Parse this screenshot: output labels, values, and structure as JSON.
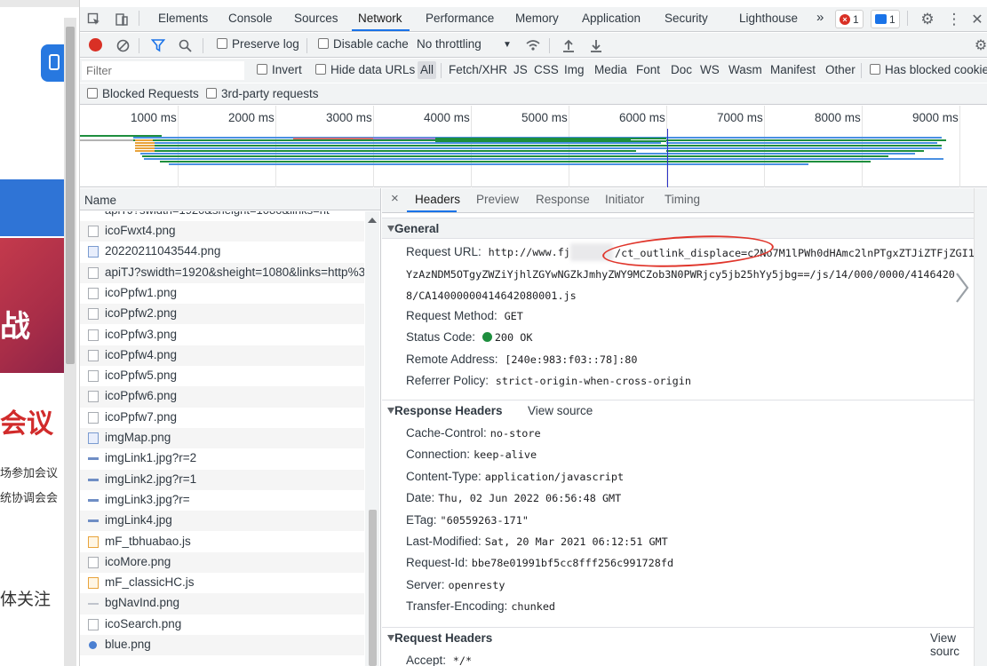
{
  "page_strip": {
    "headline_char": "战",
    "conference": "会议",
    "line1": "场参加会议",
    "line2": "统协调会会",
    "follow": "体关注"
  },
  "tabbar": {
    "tabs": [
      "Elements",
      "Console",
      "Sources",
      "Network",
      "Performance",
      "Memory",
      "Application",
      "Security",
      "Lighthouse"
    ],
    "more": "»",
    "error_count": "1",
    "message_count": "1"
  },
  "toolbar": {
    "preserve_log": "Preserve log",
    "disable_cache": "Disable cache",
    "throttling": "No throttling"
  },
  "filterbar": {
    "filter_placeholder": "Filter",
    "invert": "Invert",
    "hide_data_urls": "Hide data URLs",
    "types": [
      "All",
      "Fetch/XHR",
      "JS",
      "CSS",
      "Img",
      "Media",
      "Font",
      "Doc",
      "WS",
      "Wasm",
      "Manifest",
      "Other"
    ],
    "has_blocked": "Has blocked cookies",
    "blocked_requests": "Blocked Requests",
    "third_party": "3rd-party requests"
  },
  "overview": {
    "ticks": [
      "1000 ms",
      "2000 ms",
      "3000 ms",
      "4000 ms",
      "5000 ms",
      "6000 ms",
      "7000 ms",
      "8000 ms",
      "9000 ms"
    ]
  },
  "requests": {
    "header": "Name",
    "rows": [
      {
        "name": "icoFwxt4.png",
        "type": "doc"
      },
      {
        "name": "20220211043544.png",
        "type": "img"
      },
      {
        "name": "apiTJ?swidth=1920&sheight=1080&links=http%3",
        "type": "doc"
      },
      {
        "name": "icoPpfw1.png",
        "type": "doc"
      },
      {
        "name": "icoPpfw2.png",
        "type": "doc"
      },
      {
        "name": "icoPpfw3.png",
        "type": "doc"
      },
      {
        "name": "icoPpfw4.png",
        "type": "doc"
      },
      {
        "name": "icoPpfw5.png",
        "type": "doc"
      },
      {
        "name": "icoPpfw6.png",
        "type": "doc"
      },
      {
        "name": "icoPpfw7.png",
        "type": "doc"
      },
      {
        "name": "imgMap.png",
        "type": "img"
      },
      {
        "name": "imgLink1.jpg?r=2",
        "type": "line"
      },
      {
        "name": "imgLink2.jpg?r=1",
        "type": "line"
      },
      {
        "name": "imgLink3.jpg?r=",
        "type": "line"
      },
      {
        "name": "imgLink4.jpg",
        "type": "line"
      },
      {
        "name": "mF_tbhuabao.js",
        "type": "js"
      },
      {
        "name": "icoMore.png",
        "type": "doc"
      },
      {
        "name": "mF_classicHC.js",
        "type": "js"
      },
      {
        "name": "bgNavInd.png",
        "type": "dash"
      },
      {
        "name": "icoSearch.png",
        "type": "doc"
      },
      {
        "name": "blue.png",
        "type": "dot"
      }
    ]
  },
  "detail": {
    "tabs": [
      "Headers",
      "Preview",
      "Response",
      "Initiator",
      "Timing"
    ],
    "close": "×",
    "general": {
      "title": "General",
      "request_url_key": "Request URL:",
      "request_url_line1_a": "http://www.fj",
      "request_url_line1_b": "/ct_outlink_displace=c2No7M1lPWh0dHAmc2lnPTgxZTJiZTFjZGI1",
      "request_url_line2": "YzAzNDM5OTgyZWZiYjhlZGYwNGZkJmhyZWY9MCZob3N0PWRjcy5jb25hYy5jbg==/js/14/000/0000/4146420",
      "request_url_line3": "8/CA14000000414642080001.js",
      "method_key": "Request Method:",
      "method": "GET",
      "status_key": "Status Code:",
      "status": "200 OK",
      "remote_key": "Remote Address:",
      "remote": "[240e:983:f03::78]:80",
      "referrer_key": "Referrer Policy:",
      "referrer": "strict-origin-when-cross-origin"
    },
    "response_headers": {
      "title": "Response Headers",
      "view_source": "View source",
      "items": [
        {
          "k": "Cache-Control:",
          "v": "no-store"
        },
        {
          "k": "Connection:",
          "v": "keep-alive"
        },
        {
          "k": "Content-Type:",
          "v": "application/javascript"
        },
        {
          "k": "Date:",
          "v": "Thu, 02 Jun 2022 06:56:48 GMT"
        },
        {
          "k": "ETag:",
          "v": "\"60559263-171\""
        },
        {
          "k": "Last-Modified:",
          "v": "Sat, 20 Mar 2021 06:12:51 GMT"
        },
        {
          "k": "Request-Id:",
          "v": "bbe78e01991bf5cc8fff256c991728fd"
        },
        {
          "k": "Server:",
          "v": "openresty"
        },
        {
          "k": "Transfer-Encoding:",
          "v": "chunked"
        }
      ]
    },
    "request_headers": {
      "title": "Request Headers",
      "view_source": "View sourc",
      "accept_key": "Accept:",
      "accept": "*/*"
    }
  },
  "colors": {
    "accent": "#1a73e8",
    "record": "#d93025",
    "status_ok": "#1e8e3e",
    "annotation": "#e0352b"
  }
}
